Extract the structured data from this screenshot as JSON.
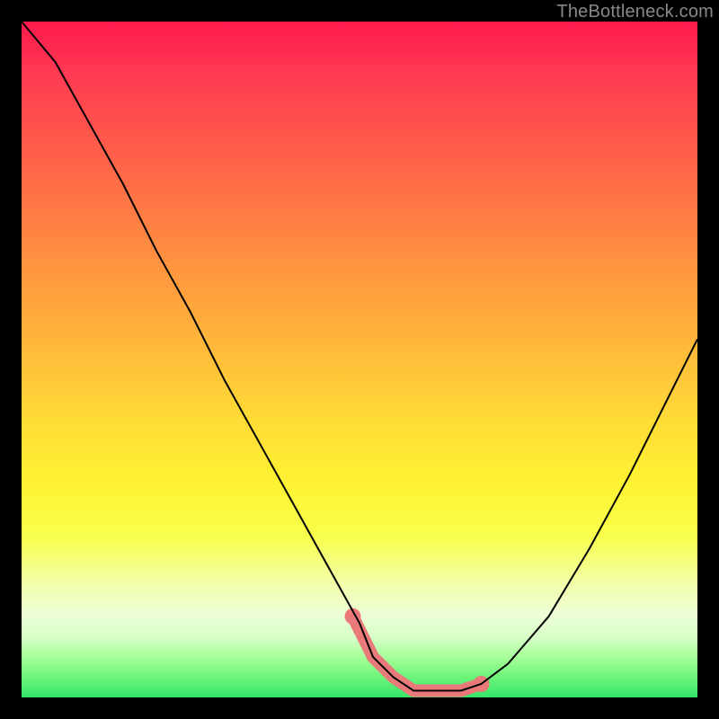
{
  "watermark": "TheBottleneck.com",
  "colors": {
    "marker": "#ea7a7a",
    "curve": "#000000"
  },
  "chart_data": {
    "type": "line",
    "title": "",
    "xlabel": "",
    "ylabel": "",
    "xlim": [
      0,
      100
    ],
    "ylim": [
      0,
      100
    ],
    "grid": false,
    "series": [
      {
        "name": "bottleneck-curve",
        "x": [
          0,
          5,
          10,
          15,
          20,
          25,
          30,
          35,
          40,
          45,
          50,
          52,
          55,
          58,
          60,
          62,
          65,
          68,
          72,
          78,
          84,
          90,
          95,
          100
        ],
        "y": [
          100,
          94,
          85,
          76,
          66,
          57,
          47,
          38,
          29,
          20,
          11,
          6,
          3,
          1,
          1,
          1,
          1,
          2,
          5,
          12,
          22,
          33,
          43,
          53
        ]
      }
    ],
    "highlight_segment": {
      "name": "optimal-range-marker",
      "x": [
        49,
        52,
        55,
        58,
        60,
        62,
        65,
        68
      ],
      "y": [
        12,
        6,
        3,
        1,
        1,
        1,
        1,
        2
      ]
    }
  }
}
